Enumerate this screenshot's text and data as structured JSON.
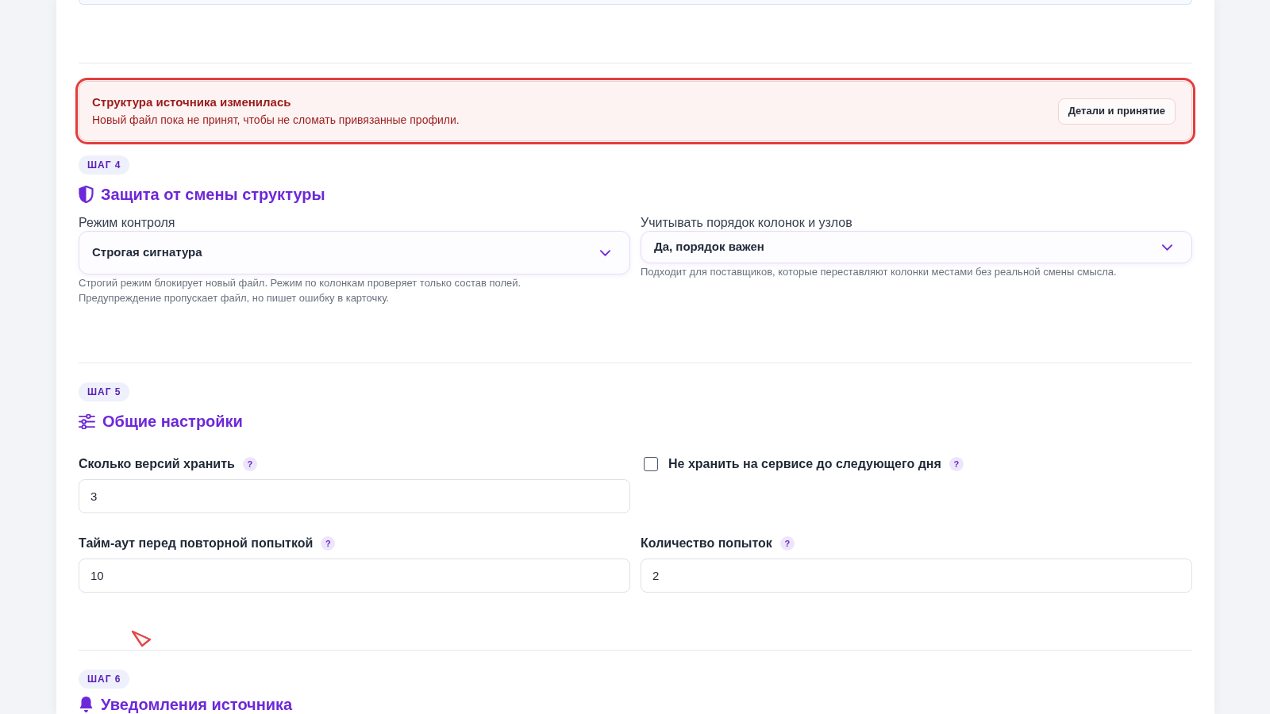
{
  "alert": {
    "title": "Структура источника изменилась",
    "message": "Новый файл пока не принят, чтобы не сломать привязанные профили.",
    "button": "Детали и принятие"
  },
  "sections": [
    {
      "kind": "structure",
      "step": "ШАГ 4",
      "title": "Защита от смены структуры",
      "fields": [
        {
          "kind": "select",
          "label": "Режим контроля",
          "value": "Строгая сигнатура",
          "hint_lines": [
            "Строгий режим блокирует новый файл. Режим по колонкам проверяет только состав полей.",
            "Предупреждение пропускает файл, но пишет ошибку в карточку."
          ]
        },
        {
          "kind": "select",
          "label": "Учитывать порядок колонок и узлов",
          "value": "Да, порядок важен",
          "hint_lines": [
            "Подходит для поставщиков, которые переставляют колонки местами без реальной смены смысла."
          ]
        }
      ]
    },
    {
      "kind": "general",
      "step": "ШАГ 5",
      "title": "Общие настройки",
      "fields": [
        {
          "kind": "number",
          "label": "Сколько версий хранить",
          "help": "?",
          "value": "3"
        },
        {
          "kind": "checkbox",
          "label": "Не хранить на сервисе до следующего дня",
          "help": "?",
          "checked": false
        },
        {
          "kind": "number",
          "label": "Тайм-аут перед повторной попыткой",
          "help": "?",
          "value": "10"
        },
        {
          "kind": "number",
          "label": "Количество попыток",
          "help": "?",
          "value": "2"
        }
      ]
    },
    {
      "kind": "notifications",
      "step": "ШАГ 6",
      "title": "Уведомления источника"
    }
  ]
}
